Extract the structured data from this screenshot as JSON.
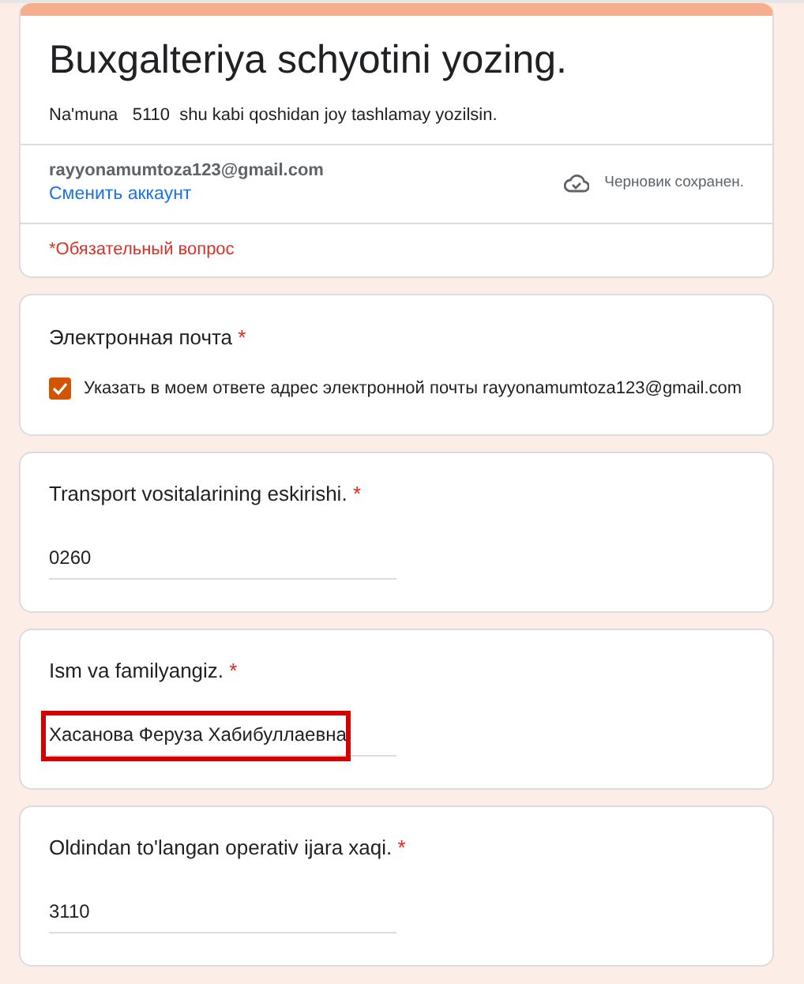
{
  "form": {
    "title": "Buxgalteriya schyotini yozing.",
    "description": "Na'muna   5110  shu kabi qoshidan joy tashlamay yozilsin.",
    "account_email": "rayyonamumtoza123@gmail.com",
    "switch_account": "Сменить аккаунт",
    "draft_status": "Черновик сохранен.",
    "required_note": "*Обязательный вопрос"
  },
  "email_question": {
    "label": "Электронная почта",
    "required_mark": "*",
    "checkbox_label": "Указать в моем ответе адрес электронной почты rayyonamumtoza123@gmail.com",
    "checked": true
  },
  "questions": [
    {
      "label": "Transport vositalarining eskirishi.",
      "required_mark": "*",
      "value": "0260",
      "highlighted": false
    },
    {
      "label": "Ism va familyangiz.",
      "required_mark": "*",
      "value": "Хасанова Феруза Хабибуллаевна",
      "highlighted": true
    },
    {
      "label": "Oldindan to'langan operativ ijara xaqi.",
      "required_mark": "*",
      "value": "3110",
      "highlighted": false
    }
  ]
}
